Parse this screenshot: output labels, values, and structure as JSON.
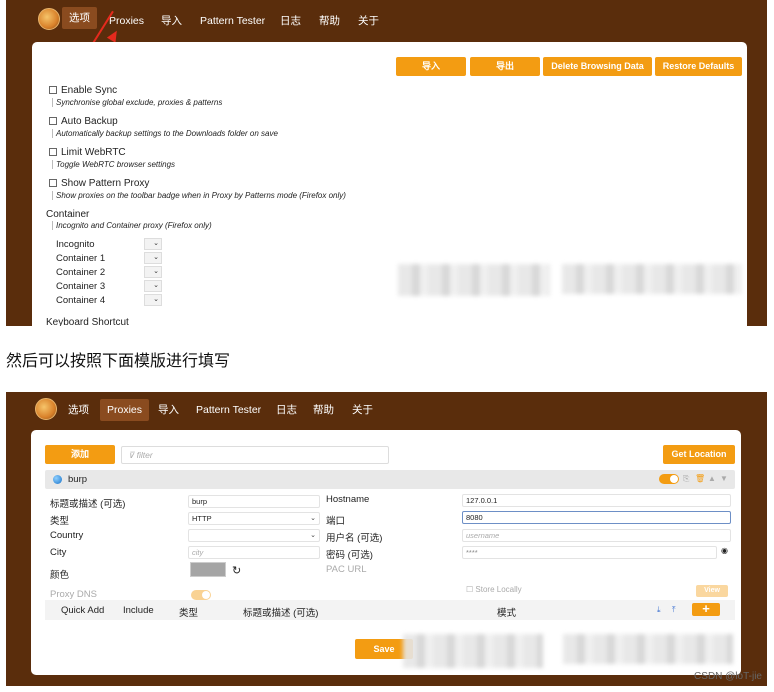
{
  "top": {
    "nav": [
      "选项",
      "Proxies",
      "导入",
      "Pattern Tester",
      "日志",
      "帮助",
      "关于"
    ],
    "actions": [
      "导入",
      "导出",
      "Delete Browsing Data",
      "Restore Defaults"
    ],
    "options": [
      {
        "title": "Enable Sync",
        "desc": "Synchronise global exclude, proxies & patterns"
      },
      {
        "title": "Auto Backup",
        "desc": "Automatically backup settings to the Downloads folder on save"
      },
      {
        "title": "Limit WebRTC",
        "desc": "Toggle WebRTC browser settings"
      },
      {
        "title": "Show Pattern Proxy",
        "desc": "Show proxies on the toolbar badge when in Proxy by Patterns mode (Firefox only)"
      }
    ],
    "container": {
      "title": "Container",
      "desc": "Incognito and Container proxy (Firefox only)",
      "items": [
        "Incognito",
        "Container 1",
        "Container 2",
        "Container 3",
        "Container 4"
      ]
    },
    "keyboard_shortcut": "Keyboard Shortcut"
  },
  "caption": "然后可以按照下面模版进行填写",
  "bottom": {
    "nav": [
      "选项",
      "Proxies",
      "导入",
      "Pattern Tester",
      "日志",
      "帮助",
      "关于"
    ],
    "add_label": "添加",
    "filter_placeholder": "filter",
    "get_location": "Get Location",
    "proxy_name": "burp",
    "form": {
      "title_label": "标题或描述 (可选)",
      "title_value": "burp",
      "type_label": "类型",
      "type_value": "HTTP",
      "country_label": "Country",
      "country_value": "",
      "city_label": "City",
      "city_placeholder": "city",
      "color_label": "颜色",
      "proxy_dns_label": "Proxy DNS",
      "hostname_label": "Hostname",
      "hostname_value": "127.0.0.1",
      "port_label": "端口",
      "port_value": "8080",
      "username_label": "用户名 (可选)",
      "username_placeholder": "username",
      "password_label": "密码 (可选)",
      "password_value": "****",
      "pac_label": "PAC URL",
      "store_locally": "Store Locally",
      "view_label": "View"
    },
    "pattern_header": [
      "Quick Add",
      "Include",
      "类型",
      "标题或描述 (可选)",
      "模式"
    ],
    "save_label": "Save"
  },
  "watermark": "CSDN @loT-jie",
  "colors": {
    "brown": "#5a2d0c",
    "orange": "#f39c12",
    "active_tab": "#8a4b1f"
  }
}
